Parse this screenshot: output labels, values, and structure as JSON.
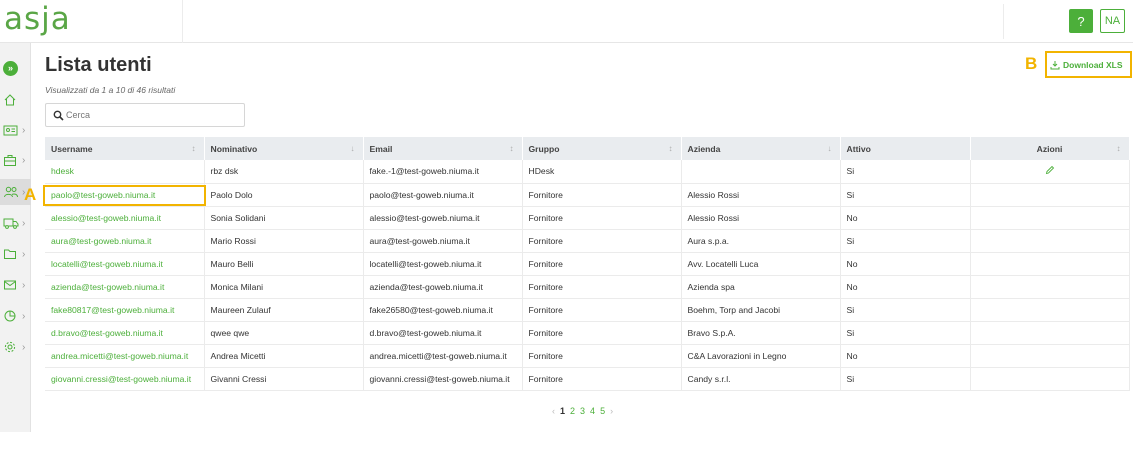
{
  "app": {
    "logo_text": "asja"
  },
  "topbar": {
    "help_label": "?",
    "avatar_initials": "NA"
  },
  "page": {
    "title": "Lista utenti",
    "results_text": "Visualizzati da 1 a 10 di 46 risultati",
    "search_placeholder": "Cerca",
    "download_label": "Download XLS"
  },
  "annotations": {
    "a": "A",
    "b": "B"
  },
  "sidebar": {
    "items": [
      {
        "icon": "expand-icon",
        "has_chevron": false
      },
      {
        "icon": "home-icon",
        "has_chevron": false
      },
      {
        "icon": "id-card-icon",
        "has_chevron": true
      },
      {
        "icon": "briefcase-icon",
        "has_chevron": true
      },
      {
        "icon": "users-icon",
        "has_chevron": true,
        "active": true
      },
      {
        "icon": "truck-icon",
        "has_chevron": true
      },
      {
        "icon": "folder-icon",
        "has_chevron": true
      },
      {
        "icon": "mail-icon",
        "has_chevron": true
      },
      {
        "icon": "chart-pie-icon",
        "has_chevron": true
      },
      {
        "icon": "settings-icon",
        "has_chevron": true
      }
    ]
  },
  "table": {
    "columns": [
      "Username",
      "Nominativo",
      "Email",
      "Gruppo",
      "Azienda",
      "Attivo",
      "Azioni"
    ],
    "rows": [
      [
        "hdesk",
        "rbz dsk",
        "fake.-1@test-goweb.niuma.it",
        "HDesk",
        "",
        "Si"
      ],
      [
        "paolo@test-goweb.niuma.it",
        "Paolo Dolo",
        "paolo@test-goweb.niuma.it",
        "Fornitore",
        "Alessio Rossi",
        "Si"
      ],
      [
        "alessio@test-goweb.niuma.it",
        "Sonia Solidani",
        "alessio@test-goweb.niuma.it",
        "Fornitore",
        "Alessio Rossi",
        "No"
      ],
      [
        "aura@test-goweb.niuma.it",
        "Mario Rossi",
        "aura@test-goweb.niuma.it",
        "Fornitore",
        "Aura s.p.a.",
        "Si"
      ],
      [
        "locatelli@test-goweb.niuma.it",
        "Mauro Belli",
        "locatelli@test-goweb.niuma.it",
        "Fornitore",
        "Avv. Locatelli Luca",
        "No"
      ],
      [
        "azienda@test-goweb.niuma.it",
        "Monica Milani",
        "azienda@test-goweb.niuma.it",
        "Fornitore",
        "Azienda spa",
        "No"
      ],
      [
        "fake80817@test-goweb.niuma.it",
        "Maureen Zulauf",
        "fake26580@test-goweb.niuma.it",
        "Fornitore",
        "Boehm, Torp and Jacobi",
        "Si"
      ],
      [
        "d.bravo@test-goweb.niuma.it",
        "qwee qwe",
        "d.bravo@test-goweb.niuma.it",
        "Fornitore",
        "Bravo S.p.A.",
        "Si"
      ],
      [
        "andrea.micetti@test-goweb.niuma.it",
        "Andrea Micetti",
        "andrea.micetti@test-goweb.niuma.it",
        "Fornitore",
        "C&A Lavorazioni in Legno",
        "No"
      ],
      [
        "giovanni.cressi@test-goweb.niuma.it",
        "Givanni Cressi",
        "giovanni.cressi@test-goweb.niuma.it",
        "Fornitore",
        "Candy s.r.l.",
        "Si"
      ]
    ]
  },
  "pagination": {
    "prev": "‹",
    "next": "›",
    "pages": [
      "1",
      "2",
      "3",
      "4",
      "5"
    ],
    "current": "1"
  },
  "colors": {
    "accent": "#4caf3a",
    "annotation": "#f2b400"
  }
}
